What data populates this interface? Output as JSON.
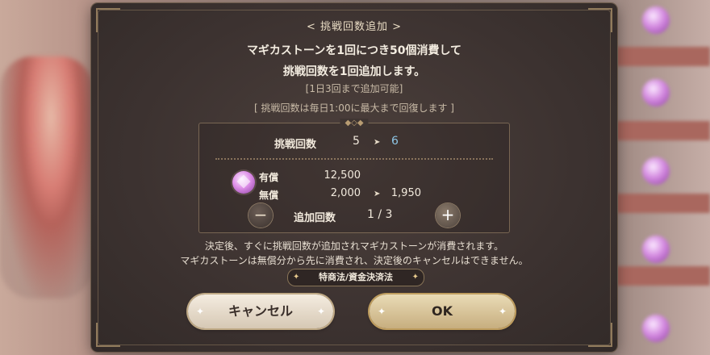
{
  "dialog": {
    "title": "< 挑戦回数追加 >",
    "message_line1": "マギカストーンを1回につき50個消費して",
    "message_line2": "挑戦回数を1回追加します。",
    "note_daily_limit": "[1日3回まで追加可能]",
    "note_recovery": "[ 挑戦回数は毎日1:00に最大まで回復します ]"
  },
  "attempts": {
    "label": "挑戦回数",
    "current": "5",
    "after": "6",
    "arrow": "➤"
  },
  "currency": {
    "icon": "magica-stone-icon",
    "paid_label": "有償",
    "paid_value": "12,500",
    "free_label": "無償",
    "free_value": "2,000",
    "free_after": "1,950",
    "arrow": "➤"
  },
  "add_count": {
    "label": "追加回数",
    "value": "1 / 3",
    "minus": "−",
    "plus": "+"
  },
  "footer": {
    "info_line1": "決定後、すぐに挑戦回数が追加されマギカストーンが消費されます。",
    "info_line2": "マギカストーンは無償分から先に消費され、決定後のキャンセルはできません。",
    "law_button": "特商法/資金決済法",
    "cancel_button": "キャンセル",
    "ok_button": "OK"
  },
  "colors": {
    "after_value": "#8ec6e6",
    "free_after_value": "#df7a6a",
    "panel_bg": "#3c3230"
  }
}
